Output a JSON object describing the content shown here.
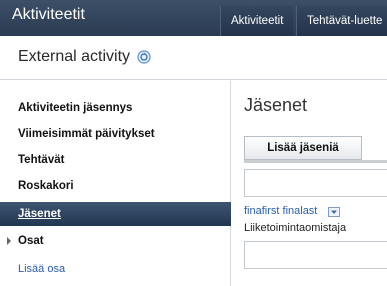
{
  "topbar": {
    "app_title": "Aktiviteetit",
    "tabs": [
      {
        "label": "Aktiviteetit"
      },
      {
        "label": "Tehtävät-luette"
      }
    ]
  },
  "context": {
    "title": "External activity"
  },
  "sidebar": {
    "items": [
      {
        "label": "Aktiviteetin jäsennys"
      },
      {
        "label": "Viimeisimmät päivitykset"
      },
      {
        "label": "Tehtävät"
      },
      {
        "label": "Roskakori"
      },
      {
        "label": "Jäsenet",
        "active": true
      },
      {
        "label": "Osat",
        "expandable": true
      }
    ],
    "add_section_link": "Lisää osa"
  },
  "main": {
    "title": "Jäsenet",
    "add_members_button": "Lisää jäseniä",
    "member": {
      "name": "finafirst finalast",
      "role": "Liiketoimintaomistaja"
    },
    "input_value": "",
    "input2_value": ""
  },
  "colors": {
    "topbar": "#2f425a",
    "active_nav": "#2c4260",
    "link": "#2a5db0"
  }
}
